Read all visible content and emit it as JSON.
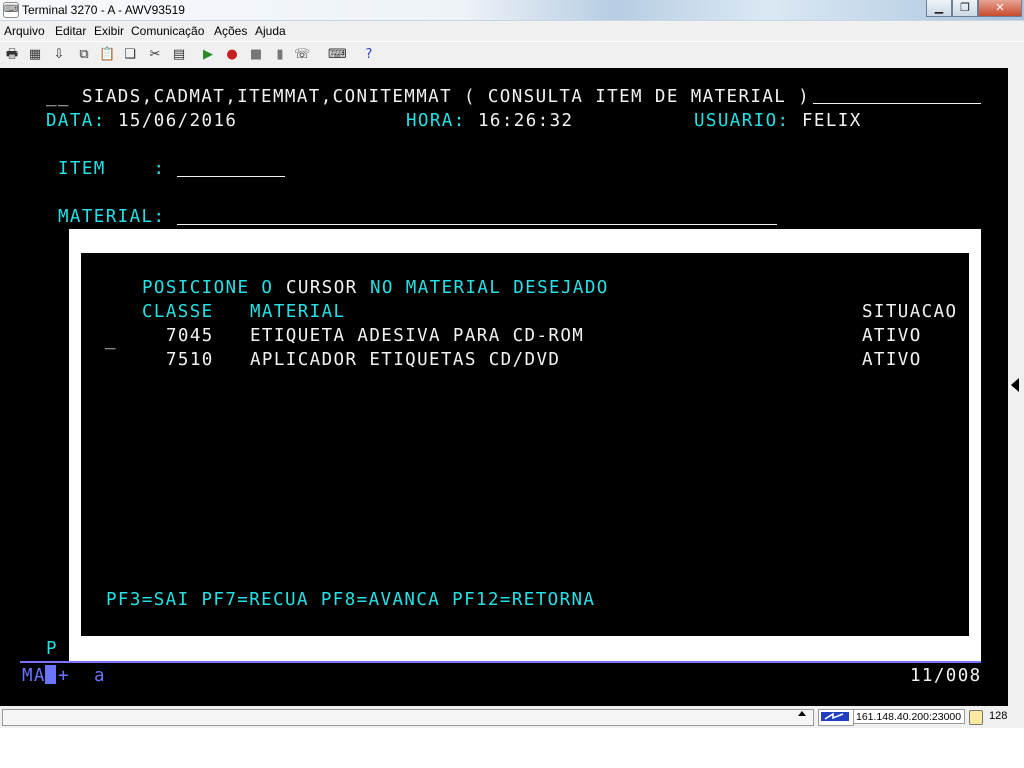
{
  "window": {
    "title": "Terminal 3270 - A - AWV93519",
    "controls": [
      "minimize",
      "maximize",
      "close"
    ]
  },
  "menu": [
    "Arquivo",
    "Editar",
    "Exibir",
    "Comunicação",
    "Ações",
    "Ajuda"
  ],
  "toolbar_icons": [
    "print-screen-icon",
    "print-setup-icon",
    "receive-file-icon",
    "copy-icon",
    "paste-icon",
    "copy-append-icon",
    "cut-icon",
    "display-icon",
    "macro-play-icon",
    "macro-record-icon",
    "macro-stop-icon",
    "macro-pause-icon",
    "send-icon",
    "keyboard-icon",
    "help-icon"
  ],
  "screen": {
    "header_left": "__",
    "header_title": "SIADS,CADMAT,ITEMMAT,CONITEMMAT ( CONSULTA ITEM DE MATERIAL )",
    "data_label": "DATA:",
    "data_value": "15/06/2016",
    "hora_label": "HORA:",
    "hora_value": "16:26:32",
    "usuario_label": "USUARIO:",
    "usuario_value": "FELIX",
    "item_label": "ITEM    :",
    "material_label": "MATERIAL:",
    "popup": {
      "instruction_1": "POSICIONE O",
      "instruction_2": "CURSOR",
      "instruction_3": "NO MATERIAL DESEJADO",
      "col_classe": "CLASSE",
      "col_material": "MATERIAL",
      "col_situacao": "SITUACAO",
      "rows": [
        {
          "classe": "7045",
          "material": "ETIQUETA ADESIVA PARA CD-ROM",
          "situacao": "ATIVO"
        },
        {
          "classe": "7510",
          "material": "APLICADOR ETIQUETAS CD/DVD",
          "situacao": "ATIVO"
        }
      ],
      "selection_cursor": "_",
      "pf_keys": "PF3=SAI PF7=RECUA PF8=AVANCA PF12=RETORNA"
    },
    "command_prompt": "P",
    "oia_mode": "MA",
    "oia_plus": "+",
    "oia_a": "a",
    "cursor_position": "11/008"
  },
  "statusbar": {
    "host": "161.148.40.200:23000",
    "encryption_bits": "128"
  }
}
